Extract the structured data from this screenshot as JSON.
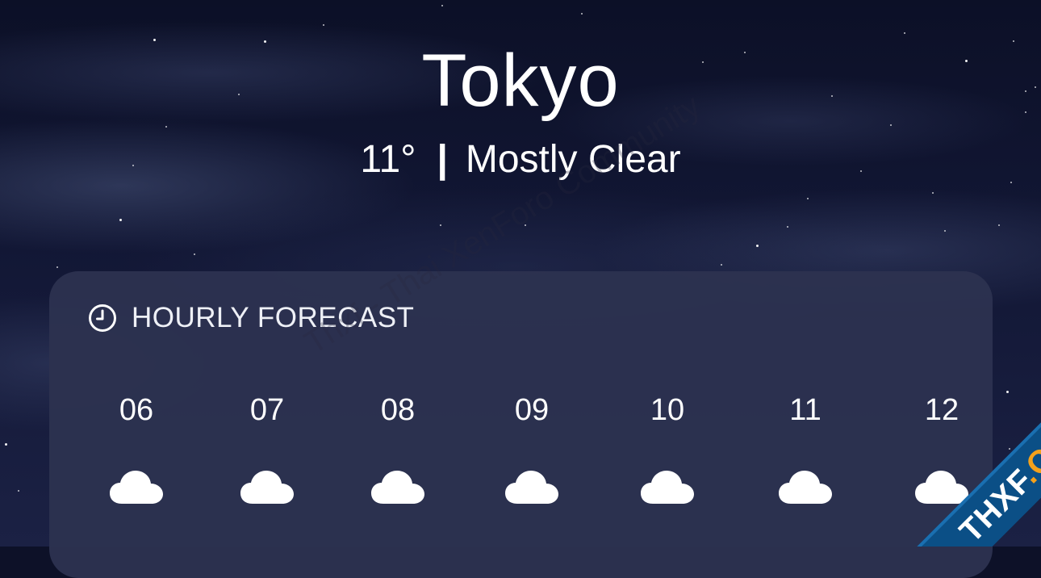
{
  "location": {
    "city": "Tokyo",
    "temperature": "11°",
    "separator": "|",
    "condition": "Mostly Clear"
  },
  "hourly_forecast": {
    "title": "HOURLY FORECAST",
    "header_icon": "clock-icon",
    "hours": [
      {
        "time": "06",
        "icon": "cloud-icon"
      },
      {
        "time": "07",
        "icon": "cloud-icon"
      },
      {
        "time": "08",
        "icon": "cloud-icon"
      },
      {
        "time": "09",
        "icon": "cloud-icon"
      },
      {
        "time": "10",
        "icon": "cloud-icon"
      },
      {
        "time": "11",
        "icon": "cloud-icon"
      },
      {
        "time": "12",
        "icon": "cloud-icon"
      }
    ]
  },
  "watermark": {
    "text": "Thxf - Thai XenForo Community"
  },
  "badge": {
    "text_main": "THXF",
    "text_accent": ".ORG"
  },
  "colors": {
    "sky_top": "#0c1027",
    "panel": "#2c324f",
    "text": "#ffffff",
    "badge_blue": "#0b4f86",
    "badge_orange": "#f4a11b"
  }
}
